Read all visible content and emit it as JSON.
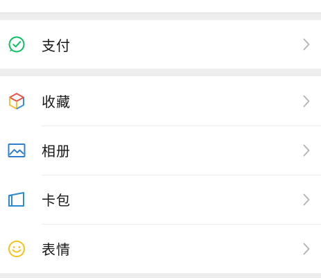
{
  "groups": [
    {
      "id": "pay-group",
      "items": [
        {
          "label": "支付",
          "icon": "payment-check-icon"
        }
      ]
    },
    {
      "id": "main-group",
      "items": [
        {
          "label": "收藏",
          "icon": "favorites-cube-icon"
        },
        {
          "label": "相册",
          "icon": "album-image-icon"
        },
        {
          "label": "卡包",
          "icon": "card-wallet-icon"
        },
        {
          "label": "表情",
          "icon": "smiley-icon"
        }
      ]
    }
  ],
  "colors": {
    "pay_green": "#07c160",
    "favorites_red": "#e8534a",
    "favorites_yellow": "#f6c02c",
    "favorites_blue": "#3b8fe0",
    "album_blue": "#2f7fd1",
    "card_blue": "#2b8ad0",
    "smiley_yellow": "#f4c21a",
    "chevron": "#b2b2b2"
  }
}
